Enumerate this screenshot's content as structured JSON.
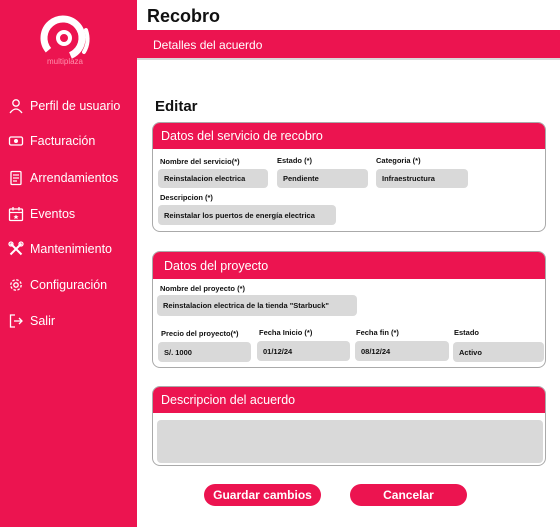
{
  "brand": {
    "logo_text": "multiplaza"
  },
  "sidebar": {
    "items": [
      {
        "label": "Perfil de usuario",
        "icon": "user-icon"
      },
      {
        "label": "Facturación",
        "icon": "money-icon"
      },
      {
        "label": "Arrendamientos",
        "icon": "document-icon"
      },
      {
        "label": "Eventos",
        "icon": "calendar-icon"
      },
      {
        "label": "Mantenimiento",
        "icon": "tools-icon"
      },
      {
        "label": "Configuración",
        "icon": "gear-icon"
      },
      {
        "label": "Salir",
        "icon": "logout-icon"
      }
    ]
  },
  "header": {
    "title": "Recobro",
    "subtitle": "Detalles del acuerdo"
  },
  "main": {
    "edit_title": "Editar",
    "service": {
      "title": "Datos del servicio de recobro",
      "nombre_label": "Nombre del servicio(*)",
      "nombre_value": "Reinstalacion electrica",
      "estado_label": "Estado (*)",
      "estado_value": "Pendiente",
      "categoria_label": "Categoria (*)",
      "categoria_value": "Infraestructura",
      "descripcion_label": "Descripcion (*)",
      "descripcion_value": "Reinstalar los puertos de energía electrica"
    },
    "project": {
      "title": "Datos del proyecto",
      "nombre_label": "Nombre del proyecto (*)",
      "nombre_value": "Reinstalacion electrica de la tienda \"Starbuck\"",
      "precio_label": "Precio del proyecto(*)",
      "precio_value": "S/. 1000",
      "inicio_label": "Fecha Inicio (*)",
      "inicio_value": "01/12/24",
      "fin_label": "Fecha fin (*)",
      "fin_value": "08/12/24",
      "estado_label": "Estado",
      "estado_value": "Activo"
    },
    "agreement": {
      "title": "Descripcion del acuerdo",
      "value": ""
    },
    "actions": {
      "save_label": "Guardar cambios",
      "cancel_label": "Cancelar"
    }
  },
  "colors": {
    "accent": "#ec1450",
    "field": "#d9d9d9"
  }
}
